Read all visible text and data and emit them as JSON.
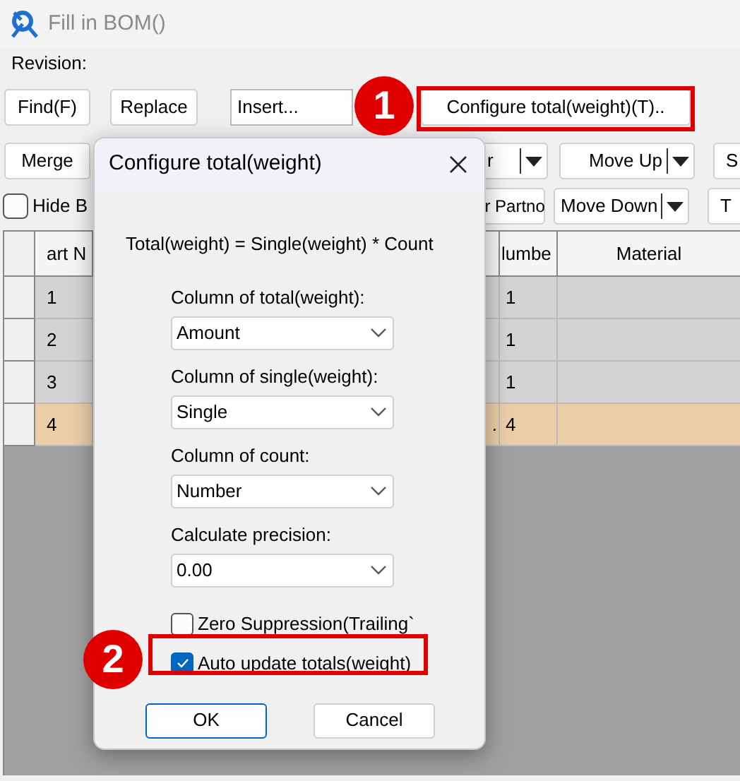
{
  "window": {
    "title": "Fill in BOM()"
  },
  "revision_label": "Revision:",
  "toolbar_row_1": [
    {
      "kind": "button",
      "label": "Find(F)"
    },
    {
      "kind": "button",
      "label": "Replace"
    },
    {
      "kind": "combo",
      "label": "Insert..."
    },
    {
      "kind": "button",
      "label": "Configure total(weight)(T).."
    }
  ],
  "toolbar_row_2": [
    {
      "kind": "button",
      "label": "Merge"
    },
    {
      "kind": "split",
      "label": "r"
    },
    {
      "kind": "split",
      "label": "Move Up"
    },
    {
      "kind": "button",
      "label": "S"
    }
  ],
  "toolbar_row_3": [
    {
      "kind": "checkbox",
      "label": "Hide B",
      "checked": false
    },
    {
      "kind": "button",
      "label": "r Partno"
    },
    {
      "kind": "split",
      "label": "Move Down"
    },
    {
      "kind": "button",
      "label": "T"
    }
  ],
  "table": {
    "columns": [
      {
        "label": "art N"
      },
      {
        "label": "lumbe"
      },
      {
        "label": "Material"
      }
    ],
    "rows": [
      {
        "part_no": "1",
        "number": "1",
        "selected": false
      },
      {
        "part_no": "2",
        "number": "1",
        "selected": false
      },
      {
        "part_no": "3",
        "number": "1",
        "selected": false
      },
      {
        "part_no": "4",
        "column_3": ".",
        "number": "4",
        "selected": true
      }
    ]
  },
  "dialog": {
    "title": "Configure total(weight)",
    "formula": "Total(weight) = Single(weight) * Count",
    "fields": [
      {
        "label": "Column of total(weight):",
        "value": "Amount"
      },
      {
        "label": "Column of single(weight):",
        "value": "Single"
      },
      {
        "label": "Column of count:",
        "value": "Number"
      },
      {
        "label": "Calculate precision:",
        "value": "0.00"
      }
    ],
    "checkboxes": [
      {
        "label": "Zero Suppression(Trailing`",
        "checked": false
      },
      {
        "label": "Auto update totals(weight)",
        "checked": true
      }
    ],
    "buttons": [
      {
        "label": "OK",
        "default": true
      },
      {
        "label": "Cancel",
        "default": false
      }
    ]
  },
  "callouts": [
    {
      "number": "1"
    },
    {
      "number": "2"
    }
  ]
}
